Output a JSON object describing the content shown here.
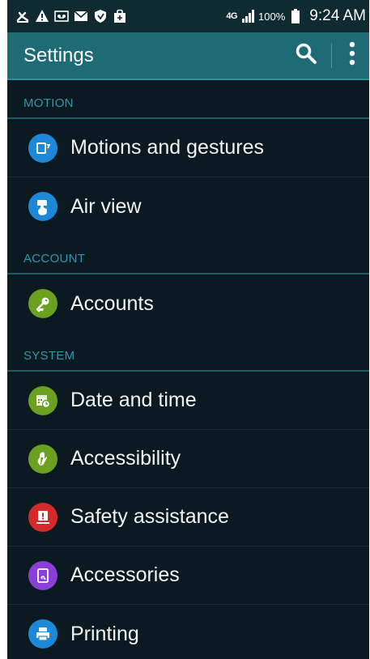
{
  "status_bar": {
    "network": "4G",
    "battery": "100%",
    "time": "9:24 AM",
    "notification_icons": [
      "missed-call-icon",
      "warning-icon",
      "voicemail-icon",
      "email-icon",
      "shield-icon",
      "shopping-bag-icon"
    ]
  },
  "action_bar": {
    "title": "Settings",
    "search_icon": "search-icon",
    "more_icon": "more-vert-icon"
  },
  "sections": [
    {
      "header": "MOTION",
      "items": [
        {
          "label": "Motions and gestures",
          "icon": "motion-icon",
          "color": "#1e88d8"
        },
        {
          "label": "Air view",
          "icon": "air-view-icon",
          "color": "#1e88d8"
        }
      ]
    },
    {
      "header": "ACCOUNT",
      "items": [
        {
          "label": "Accounts",
          "icon": "key-icon",
          "color": "#6aa121"
        }
      ]
    },
    {
      "header": "SYSTEM",
      "items": [
        {
          "label": "Date and time",
          "icon": "calendar-clock-icon",
          "color": "#6aa121"
        },
        {
          "label": "Accessibility",
          "icon": "hand-icon",
          "color": "#6aa121"
        },
        {
          "label": "Safety assistance",
          "icon": "safety-icon",
          "color": "#d42a2a"
        },
        {
          "label": "Accessories",
          "icon": "accessory-icon",
          "color": "#8a3fd8"
        },
        {
          "label": "Printing",
          "icon": "printer-icon",
          "color": "#1e88d8"
        }
      ]
    }
  ]
}
